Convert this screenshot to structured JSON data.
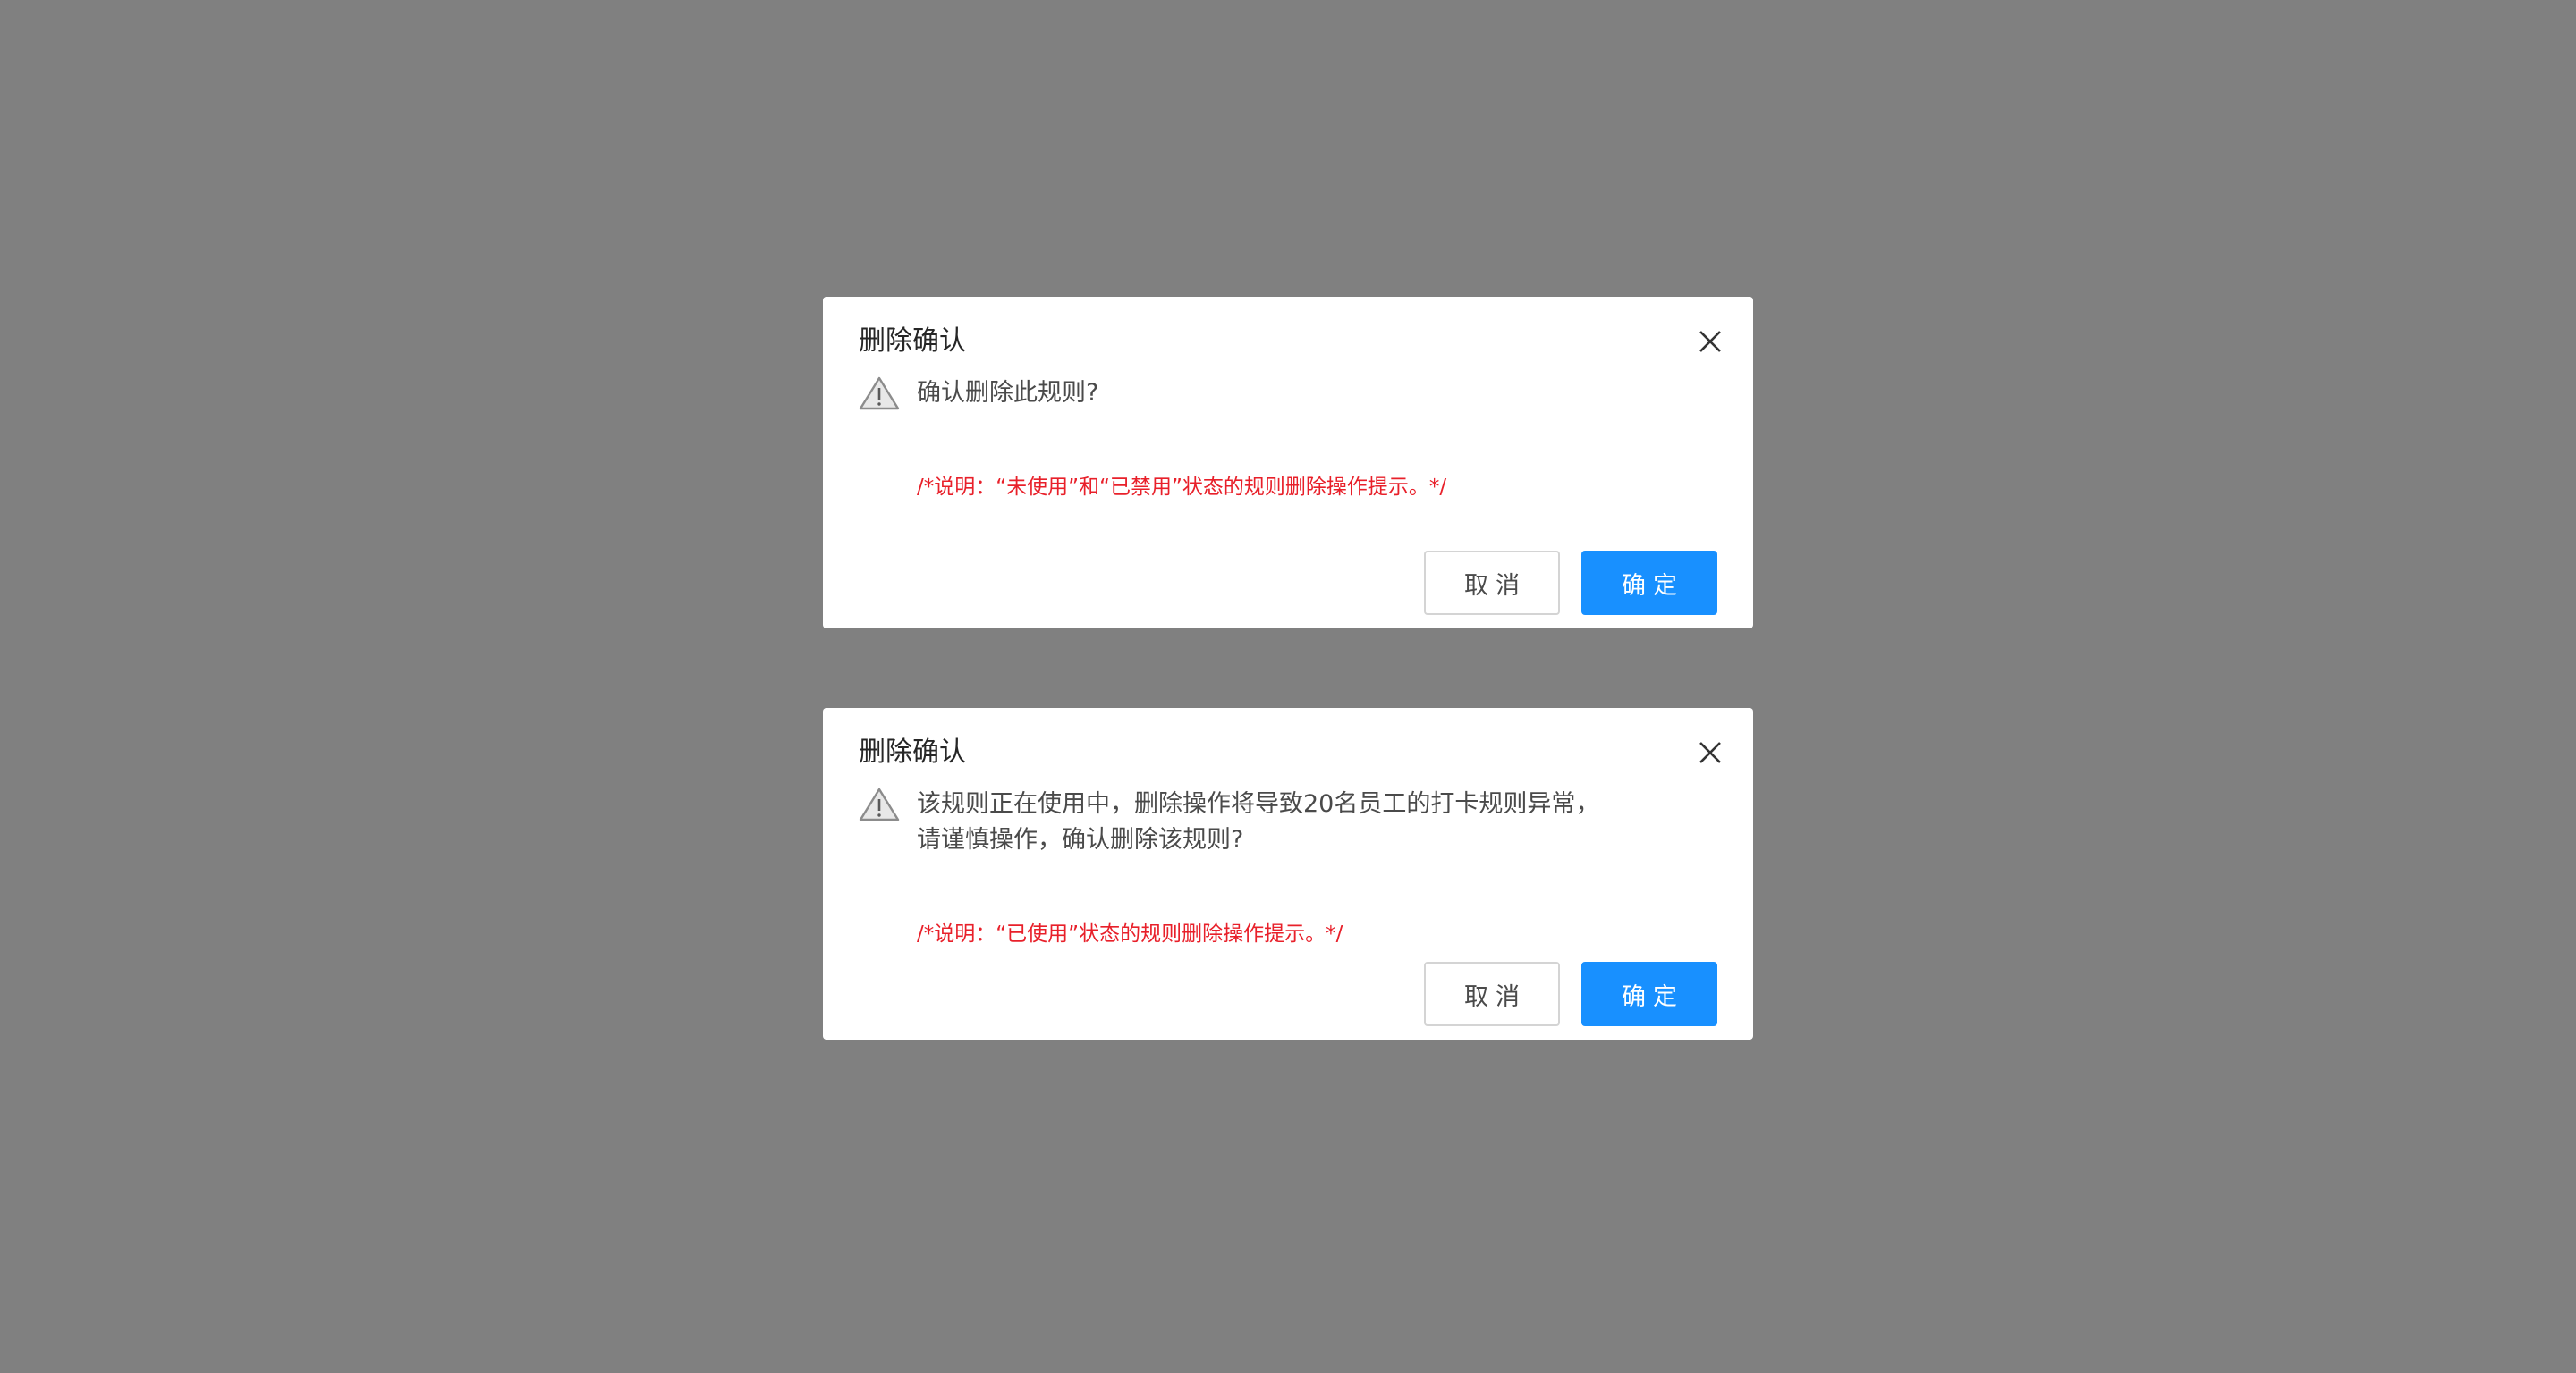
{
  "dialogs": [
    {
      "title": "删除确认",
      "message_lines": [
        "确认删除此规则?"
      ],
      "note": "/*说明：“未使用”和“已禁用”状态的规则删除操作提示。*/",
      "cancel_label": "取消",
      "ok_label": "确定"
    },
    {
      "title": "删除确认",
      "message_lines": [
        "该规则正在使用中，删除操作将导致20名员工的打卡规则异常，",
        "请谨慎操作，确认删除该规则?"
      ],
      "note": "/*说明：“已使用”状态的规则删除操作提示。*/",
      "cancel_label": "取消",
      "ok_label": "确定"
    }
  ],
  "icons": {
    "close": "close-icon",
    "warning": "warning-triangle-icon"
  },
  "colors": {
    "overlay": "#808080",
    "primary": "#1890ff",
    "note": "#e8202a",
    "text": "#4a4a4a"
  }
}
